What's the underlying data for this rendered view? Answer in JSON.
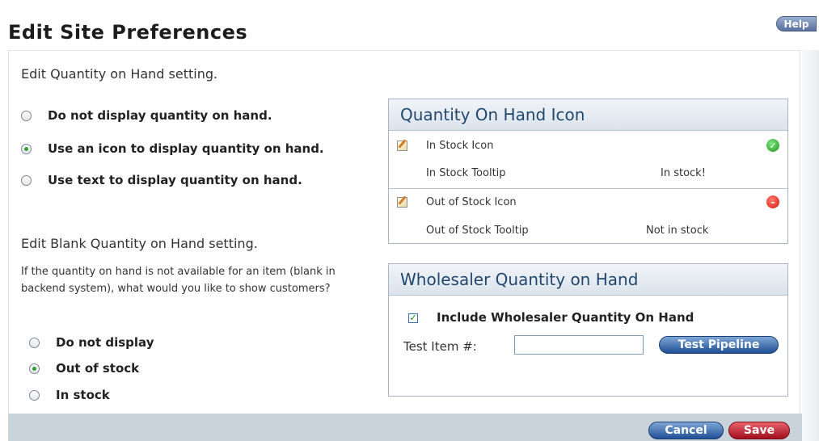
{
  "page_title": "Edit Site Preferences",
  "help_label": "Help",
  "qoh_setting": {
    "heading": "Edit Quantity on Hand setting.",
    "options": [
      {
        "label": "Do not display quantity on hand.",
        "checked": false
      },
      {
        "label": "Use an icon to display quantity on hand.",
        "checked": true
      },
      {
        "label": "Use text to display quantity on hand.",
        "checked": false
      }
    ]
  },
  "blank_setting": {
    "heading": "Edit Blank Quantity on Hand setting.",
    "description": "If the quantity on hand is not available for an item (blank in backend system), what would you like to show customers?",
    "options": [
      {
        "label": "Do not display",
        "checked": false
      },
      {
        "label": "Out of stock",
        "checked": true
      },
      {
        "label": "In stock",
        "checked": false
      }
    ]
  },
  "qoh_icon_box": {
    "title": "Quantity On Hand Icon",
    "in_stock_icon_label": "In Stock Icon",
    "in_stock_tooltip_label": "In Stock Tooltip",
    "in_stock_tooltip_value": "In stock!",
    "out_of_stock_icon_label": "Out of Stock Icon",
    "out_of_stock_tooltip_label": "Out of Stock Tooltip",
    "out_of_stock_tooltip_value": "Not in stock",
    "in_stock_icon": "green-check-icon",
    "out_of_stock_icon": "red-minus-icon"
  },
  "wholesaler_box": {
    "title": "Wholesaler Quantity on Hand",
    "checkbox_label": "Include Wholesaler Quantity On Hand",
    "checkbox_checked": true,
    "test_item_label": "Test Item #:",
    "test_item_value": "",
    "test_button": "Test Pipeline"
  },
  "footer": {
    "cancel_label": "Cancel",
    "save_label": "Save"
  },
  "colors": {
    "box_title": "#22486d",
    "save_button": "#b01424",
    "blue_button": "#2a5ca3",
    "footer_bar": "#c9d3dc"
  }
}
